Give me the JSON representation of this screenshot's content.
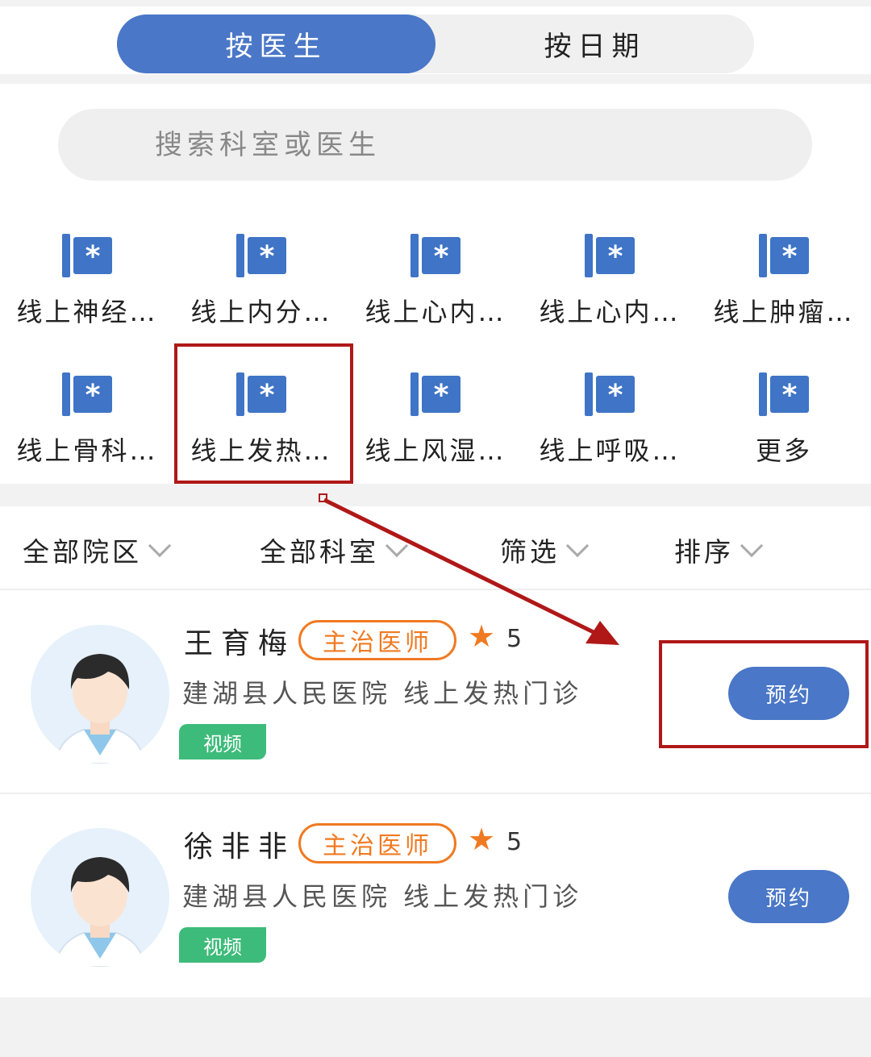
{
  "tabs": {
    "by_doctor": "按医生",
    "by_date": "按日期"
  },
  "search": {
    "placeholder": "搜索科室或医生"
  },
  "departments": [
    {
      "label": "线上神经…"
    },
    {
      "label": "线上内分…"
    },
    {
      "label": "线上心内…"
    },
    {
      "label": "线上心内…"
    },
    {
      "label": "线上肿瘤…"
    },
    {
      "label": "线上骨科…"
    },
    {
      "label": "线上发热…"
    },
    {
      "label": "线上风湿…"
    },
    {
      "label": "线上呼吸…"
    },
    {
      "label": "更多"
    }
  ],
  "filters": {
    "campus": "全部院区",
    "department": "全部科室",
    "screen": "筛选",
    "sort": "排序"
  },
  "doctors": [
    {
      "name": "王育梅",
      "title": "主治医师",
      "rating": "5",
      "hospital": "建湖县人民医院 线上发热门诊",
      "tag": "视频",
      "book": "预约"
    },
    {
      "name": "徐非非",
      "title": "主治医师",
      "rating": "5",
      "hospital": "建湖县人民医院 线上发热门诊",
      "tag": "视频",
      "book": "预约"
    }
  ],
  "colors": {
    "accent": "#4a77c7",
    "orange": "#f07a22",
    "green": "#3dbb7a",
    "annotation": "#b01818"
  },
  "icons": {
    "department": "hospital-flag-icon",
    "star": "star-icon"
  }
}
